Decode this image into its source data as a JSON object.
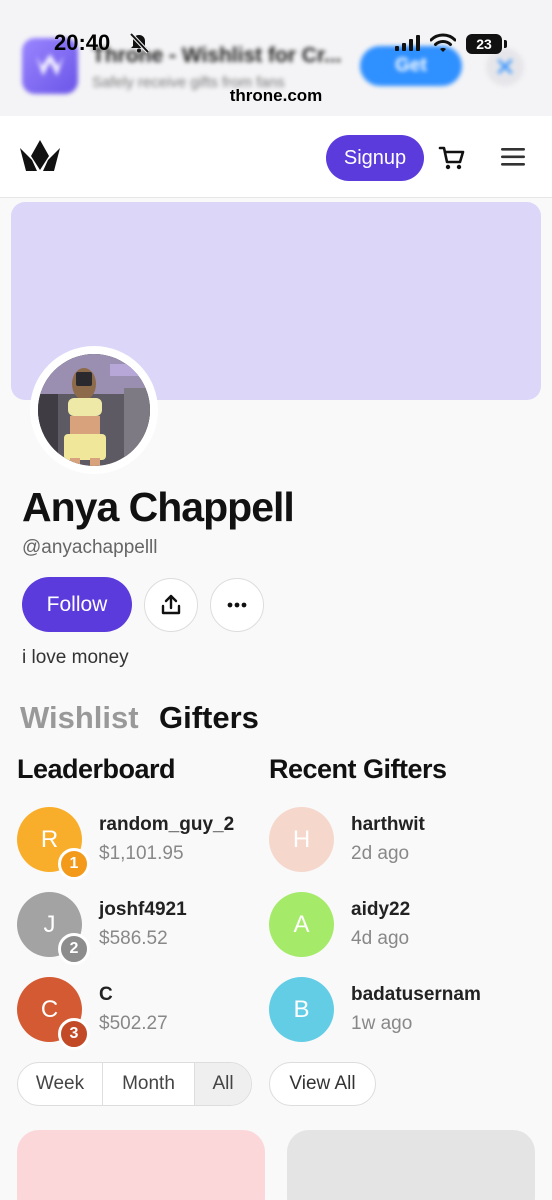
{
  "status_bar": {
    "time": "20:40",
    "battery": "23"
  },
  "app_banner": {
    "title": "Throne - Wishlist for Cr...",
    "subtitle": "Safely receive gifts from fans",
    "get_label": "Get",
    "close_icon": "close-icon"
  },
  "browser": {
    "domain": "throne.com"
  },
  "nav": {
    "signup_label": "Signup",
    "icons": [
      "throne-logo-icon",
      "cart-icon",
      "menu-icon"
    ]
  },
  "profile": {
    "name": "Anya Chappell",
    "handle": "@anyachappelll",
    "follow_label": "Follow",
    "bio": "i love money",
    "cover_color": "#dcd6f8",
    "accent": "#5b3bdc"
  },
  "tabs": [
    {
      "label": "Wishlist",
      "active": false
    },
    {
      "label": "Gifters",
      "active": true
    }
  ],
  "leaderboard": {
    "title": "Leaderboard",
    "items": [
      {
        "initial": "R",
        "name": "random_guy_2",
        "amount": "$1,101.95",
        "rank": "1",
        "color": "#f9ae2b",
        "rank_color": "#f39a1a"
      },
      {
        "initial": "J",
        "name": "joshf4921",
        "amount": "$586.52",
        "rank": "2",
        "color": "#a3a3a3",
        "rank_color": "#8d8d8d"
      },
      {
        "initial": "C",
        "name": "C",
        "amount": "$502.27",
        "rank": "3",
        "color": "#d45a33",
        "rank_color": "#c24a26"
      }
    ],
    "filters": [
      "Week",
      "Month",
      "All"
    ],
    "active_filter": "All"
  },
  "recent": {
    "title": "Recent Gifters",
    "items": [
      {
        "initial": "H",
        "name": "harthwit",
        "time": "2d ago",
        "color": "#f5d7cc"
      },
      {
        "initial": "A",
        "name": "aidy22",
        "time": "4d ago",
        "color": "#a6ea6a"
      },
      {
        "initial": "B",
        "name": "badatusernam",
        "time": "1w ago",
        "color": "#64cde6"
      }
    ],
    "view_all_label": "View All"
  }
}
